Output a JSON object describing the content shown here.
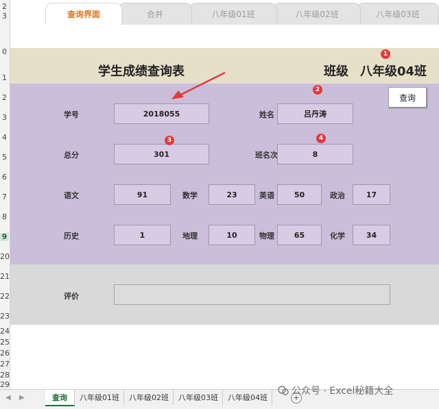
{
  "top_tabs": [
    {
      "label": "查询界面",
      "active": true
    },
    {
      "label": "合并",
      "active": false
    },
    {
      "label": "八年级01班",
      "active": false
    },
    {
      "label": "八年级02班",
      "active": false
    },
    {
      "label": "八年级03班",
      "active": false
    }
  ],
  "row_numbers": [
    "2",
    "3",
    "0",
    "1",
    "2",
    "3",
    "4",
    "5",
    "6",
    "7",
    "8",
    "9",
    "20",
    "21",
    "22",
    "23",
    "24",
    "25",
    "26",
    "27",
    "28",
    "29"
  ],
  "header": {
    "title": "学生成绩查询表",
    "class_label": "班级",
    "class_value": "八年级04班"
  },
  "query_button": "查询",
  "fields": {
    "student_id": {
      "label": "学号",
      "value": "2018055"
    },
    "name": {
      "label": "姓名",
      "value": "吕丹涛"
    },
    "total": {
      "label": "总分",
      "value": "301"
    },
    "class_rank": {
      "label": "班名次",
      "value": "8"
    }
  },
  "subjects": [
    {
      "label": "语文",
      "value": "91"
    },
    {
      "label": "数学",
      "value": "23"
    },
    {
      "label": "英语",
      "value": "50"
    },
    {
      "label": "政治",
      "value": "17"
    },
    {
      "label": "历史",
      "value": "1"
    },
    {
      "label": "地理",
      "value": "10"
    },
    {
      "label": "物理",
      "value": "65"
    },
    {
      "label": "化学",
      "value": "34"
    }
  ],
  "evaluation": {
    "label": "评价",
    "value": ""
  },
  "badges": [
    "1",
    "2",
    "3",
    "4"
  ],
  "sheet_tabs": [
    {
      "label": "查询",
      "active": true
    },
    {
      "label": "八年级01班",
      "active": false
    },
    {
      "label": "八年级02班",
      "active": false
    },
    {
      "label": "八年级03班",
      "active": false
    },
    {
      "label": "八年级04班",
      "active": false
    }
  ],
  "watermark": "公众号 · Excel秘籍大全",
  "colors": {
    "accent_orange": "#e0761f",
    "badge_red": "#e23b3b",
    "sheet_green": "#1e6b3c"
  }
}
